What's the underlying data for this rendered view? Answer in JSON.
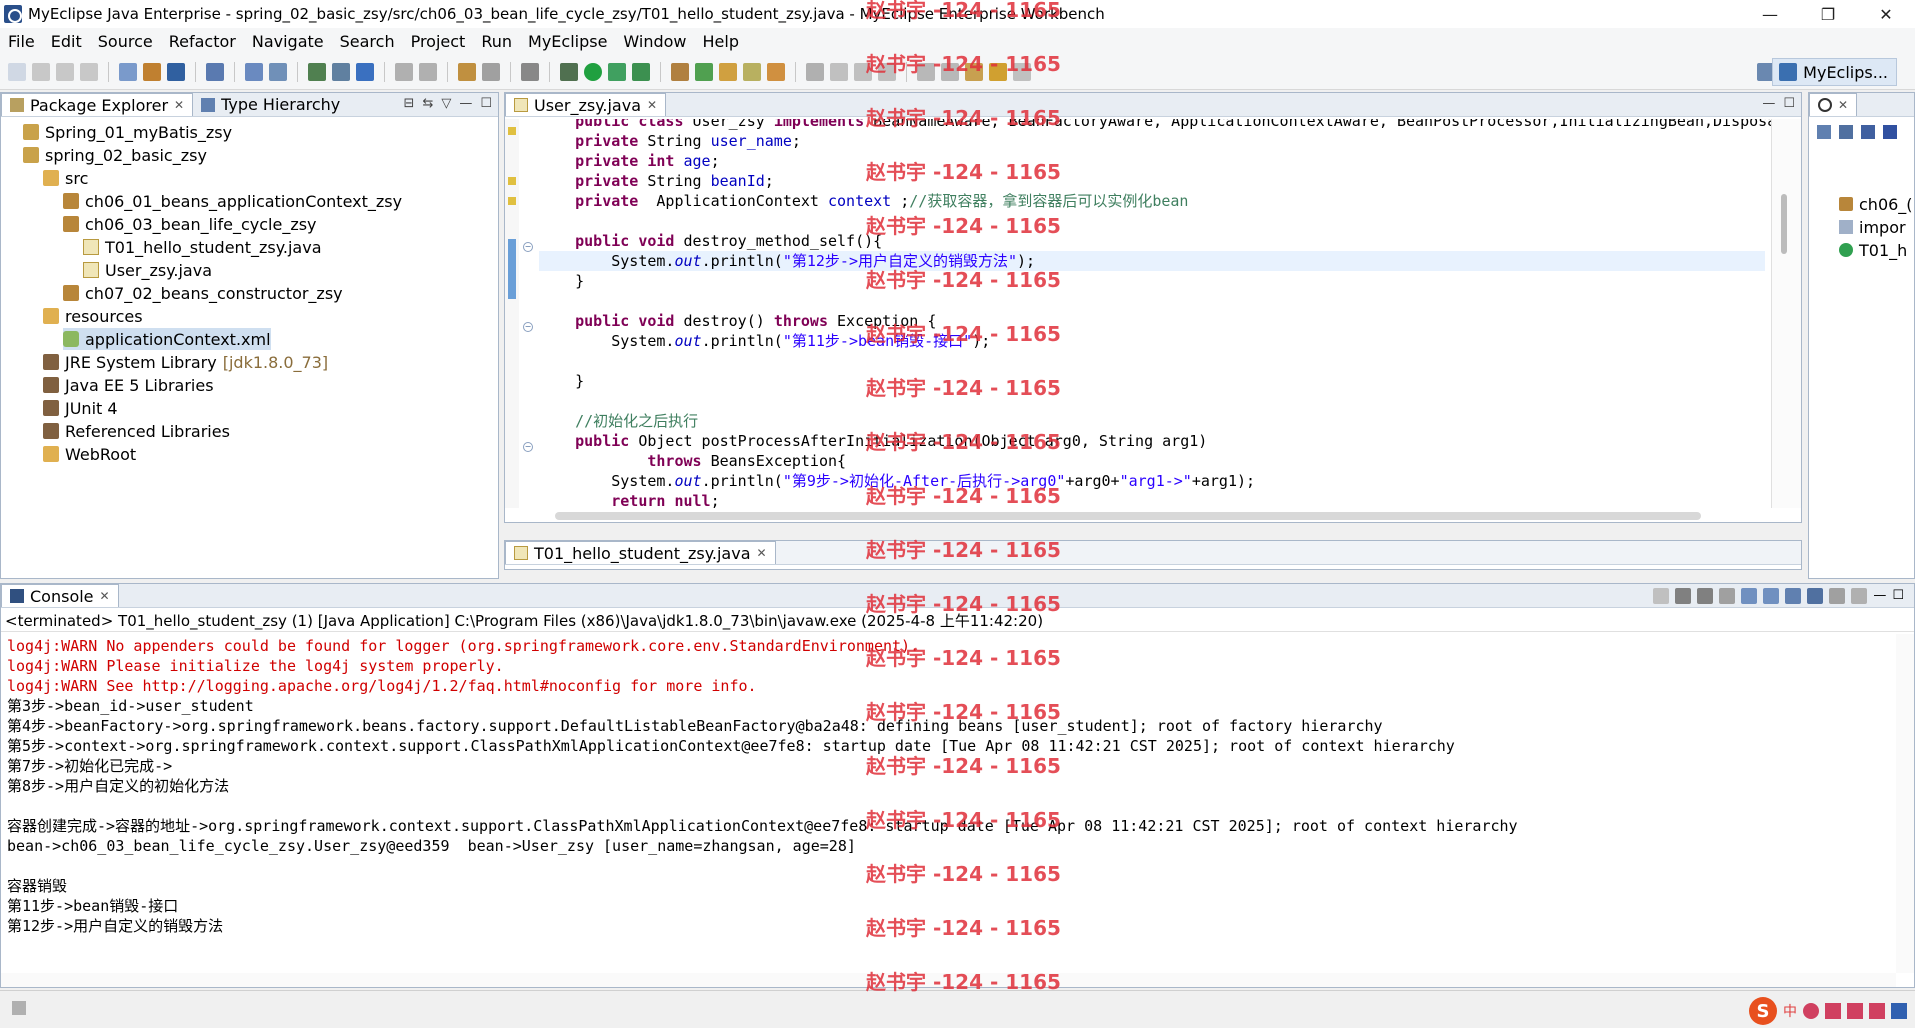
{
  "window": {
    "title": "MyEclipse Java Enterprise - spring_02_basic_zsy/src/ch06_03_bean_life_cycle_zsy/T01_hello_student_zsy.java - MyEclipse Enterprise Workbench",
    "minimize": "—",
    "maximize": "❐",
    "close": "✕"
  },
  "menu": [
    "File",
    "Edit",
    "Source",
    "Refactor",
    "Navigate",
    "Search",
    "Project",
    "Run",
    "MyEclipse",
    "Window",
    "Help"
  ],
  "toolbar": {
    "perspective_label": "MyEclips..."
  },
  "package_explorer": {
    "tab_label": "Package Explorer",
    "type_hierarchy_tab": "Type Hierarchy",
    "tree": [
      {
        "label": "Spring_01_myBatis_zsy",
        "icon": "project-icon",
        "indent": 0
      },
      {
        "label": "spring_02_basic_zsy",
        "icon": "project-icon",
        "indent": 0
      },
      {
        "label": "src",
        "icon": "source-folder-icon",
        "indent": 1
      },
      {
        "label": "ch06_01_beans_applicationContext_zsy",
        "icon": "package-icon",
        "indent": 2
      },
      {
        "label": "ch06_03_bean_life_cycle_zsy",
        "icon": "package-icon",
        "indent": 2
      },
      {
        "label": "T01_hello_student_zsy.java",
        "icon": "java-file-icon",
        "indent": 3
      },
      {
        "label": "User_zsy.java",
        "icon": "java-file-icon",
        "indent": 3
      },
      {
        "label": "ch07_02_beans_constructor_zsy",
        "icon": "package-icon",
        "indent": 2
      },
      {
        "label": "resources",
        "icon": "source-folder-icon",
        "indent": 1
      },
      {
        "label": "applicationContext.xml",
        "icon": "xml-file-icon",
        "indent": 2,
        "selected": true
      },
      {
        "label": "JRE System Library",
        "sub": "[jdk1.8.0_73]",
        "icon": "library-icon",
        "indent": 1
      },
      {
        "label": "Java EE 5 Libraries",
        "icon": "library-icon",
        "indent": 1
      },
      {
        "label": "JUnit 4",
        "icon": "library-icon",
        "indent": 1
      },
      {
        "label": "Referenced Libraries",
        "icon": "library-icon",
        "indent": 1
      },
      {
        "label": "WebRoot",
        "icon": "folder-icon",
        "indent": 1
      }
    ]
  },
  "editor": {
    "tab_label": "User_zsy.java",
    "second_tab_label": "T01_hello_student_zsy.java",
    "lines": [
      {
        "html": "    <span class='kw'>public class</span> User_zsy <span class='kw'>implements</span> BeanNameAware, BeanFactoryAware, ApplicationContextAware, BeanPostProcessor,InitializingBean,Disposabl"
      },
      {
        "html": "    <span class='kw'>private</span> String <span class='fld'>user_name</span>;"
      },
      {
        "html": "    <span class='kw'>private int</span> <span class='fld'>age</span>;"
      },
      {
        "html": "    <span class='kw'>private</span> String <span class='fld'>beanId</span>;"
      },
      {
        "html": "    <span class='kw'>private</span>  ApplicationContext <span class='fld'>context</span> ;<span class='cm'>//获取容器，拿到容器后可以实例化bean</span>"
      },
      {
        "html": ""
      },
      {
        "html": "    <span class='kw'>public void</span> destroy_method_self(){"
      },
      {
        "html": "        System.<span class='it'>out</span>.println(<span class='st'>\"第12步->用户自定义的销毁方法\"</span>);",
        "current": true
      },
      {
        "html": "    }"
      },
      {
        "html": ""
      },
      {
        "html": "    <span class='kw'>public void</span> destroy() <span class='kw'>throws</span> Exception {"
      },
      {
        "html": "        System.<span class='it'>out</span>.println(<span class='st'>\"第11步->bean销毁-接口\"</span>);"
      },
      {
        "html": ""
      },
      {
        "html": "    }"
      },
      {
        "html": ""
      },
      {
        "html": "    <span class='cm'>//初始化之后执行</span>"
      },
      {
        "html": "    <span class='kw'>public</span> Object postProcessAfterInitialization(Object arg0, String arg1)"
      },
      {
        "html": "            <span class='kw'>throws</span> BeansException{"
      },
      {
        "html": "        System.<span class='it'>out</span>.println(<span class='st'>\"第9步->初始化-After-后执行->arg0\"</span>+arg0+<span class='st'>\"arg1->\"</span>+arg1);"
      },
      {
        "html": "        <span class='kw'>return null</span>;"
      },
      {
        "html": "    }"
      }
    ]
  },
  "outline": {
    "items": [
      "ch06_(",
      "impor",
      "T01_h"
    ]
  },
  "console": {
    "tab_label": "Console",
    "header": "<terminated> T01_hello_student_zsy (1) [Java Application] C:\\Program Files (x86)\\Java\\jdk1.8.0_73\\bin\\javaw.exe (2025-4-8 上午11:42:20)",
    "lines": [
      {
        "text": "log4j:WARN No appenders could be found for logger (org.springframework.core.env.StandardEnvironment).",
        "err": true
      },
      {
        "text": "log4j:WARN Please initialize the log4j system properly.",
        "err": true
      },
      {
        "text": "log4j:WARN See http://logging.apache.org/log4j/1.2/faq.html#noconfig for more info.",
        "err": true
      },
      {
        "text": "第3步->bean_id->user_student"
      },
      {
        "text": "第4步->beanFactory->org.springframework.beans.factory.support.DefaultListableBeanFactory@ba2a48: defining beans [user_student]; root of factory hierarchy"
      },
      {
        "text": "第5步->context->org.springframework.context.support.ClassPathXmlApplicationContext@ee7fe8: startup date [Tue Apr 08 11:42:21 CST 2025]; root of context hierarchy"
      },
      {
        "text": "第7步->初始化已完成->"
      },
      {
        "text": "第8步->用户自定义的初始化方法"
      },
      {
        "text": ""
      },
      {
        "text": "容器创建完成->容器的地址->org.springframework.context.support.ClassPathXmlApplicationContext@ee7fe8: startup date [Tue Apr 08 11:42:21 CST 2025]; root of context hierarchy"
      },
      {
        "text": "bean->ch06_03_bean_life_cycle_zsy.User_zsy@eed359  bean->User_zsy [user_name=zhangsan, age=28]"
      },
      {
        "text": ""
      },
      {
        "text": "容器销毁"
      },
      {
        "text": "第11步->bean销毁-接口"
      },
      {
        "text": "第12步->用户自定义的销毁方法"
      }
    ]
  },
  "watermark": "赵书宇 -124 - 1165",
  "status": {
    "ime_label": "中"
  }
}
